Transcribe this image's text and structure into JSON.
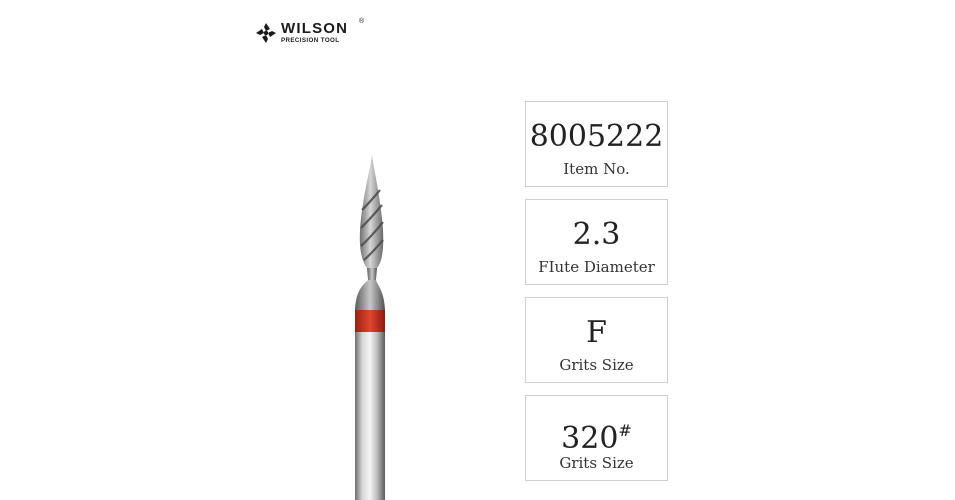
{
  "brand": {
    "name": "WILSON",
    "registered": "®",
    "subtitle": "PRECISION TOOL"
  },
  "specs": [
    {
      "value": "8005222",
      "label": "Item No."
    },
    {
      "value": "2.3",
      "label": "FIute Diameter"
    },
    {
      "value": "F",
      "label": "Grits Size"
    },
    {
      "value": "320",
      "value_suffix": "#",
      "label": "Grits Size"
    }
  ],
  "colors": {
    "grit_band": "#d23a26",
    "box_border": "#cfcfcf"
  }
}
